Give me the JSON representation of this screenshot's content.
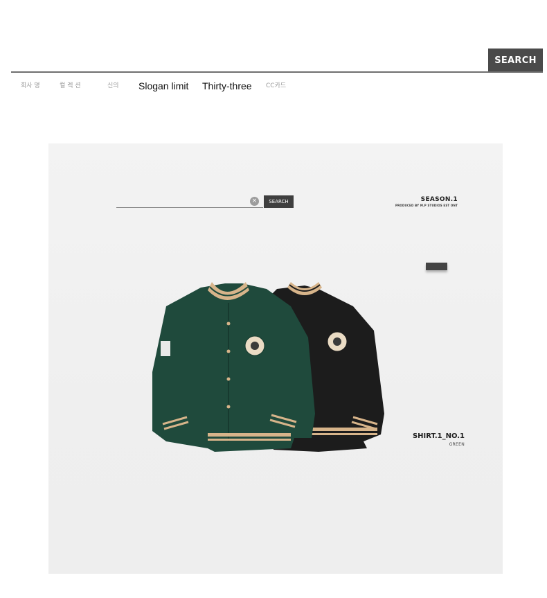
{
  "header": {
    "search_button_label": "SEARCH",
    "nav": [
      {
        "label": "회사 명",
        "style": "small"
      },
      {
        "label": "컬 렉 션",
        "style": "small"
      },
      {
        "label": "신의",
        "style": "small"
      },
      {
        "label": "Slogan limit",
        "style": "strong"
      },
      {
        "label": "Thirty-three",
        "style": "strong"
      },
      {
        "label": "CC카드",
        "style": "small"
      }
    ]
  },
  "product": {
    "search_button_label": "SEARCH",
    "clear_icon_label": "×",
    "season_title": "SEASON.1",
    "season_subtitle": "PRODUCED BY M.P STUDIOS EST ONT",
    "shirt_title": "SHIRT.1_NO.1",
    "shirt_color": "GREEN",
    "colors": {
      "green_jacket": "#1f4a3c",
      "black_jacket": "#1c1c1c",
      "rib_stripe": "#d7b48a",
      "panel_bg": "#f0f0f0"
    }
  }
}
